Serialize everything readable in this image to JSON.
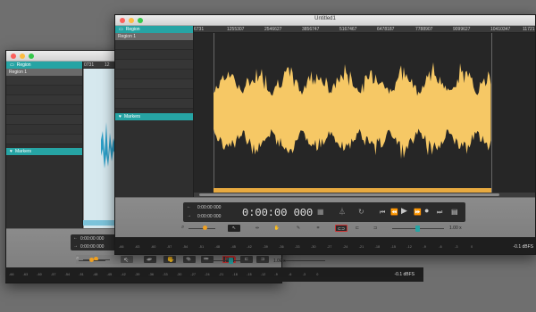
{
  "colors": {
    "accent": "#26a4a4",
    "waveform": "#f6c865",
    "waveform_back": "#2c9ec7",
    "region_bar": "#e8aa40",
    "playhead": "#f0a020"
  },
  "front": {
    "title": "Untitled1",
    "sidebar": {
      "region_header": "Region",
      "region_item": "Region 1",
      "markers_header": "Markers"
    },
    "ruler_ticks": [
      "6731",
      "1255307",
      "2546627",
      "3856747",
      "5167467",
      "6478187",
      "7788907",
      "9099627",
      "10410347",
      "11721"
    ],
    "transport": {
      "start_time": "0:00:00 000",
      "end_time": "0:00:00 000",
      "timecode": "0:00:00 000"
    },
    "zoom": "1.00 x",
    "meter_ticks": [
      "-66",
      "-63",
      "-60",
      "-57",
      "-54",
      "-51",
      "-48",
      "-45",
      "-42",
      "-39",
      "-36",
      "-33",
      "-30",
      "-27",
      "-24",
      "-21",
      "-18",
      "-15",
      "-12",
      "-9",
      "-6",
      "-3",
      "0"
    ],
    "dbfs": "-0.1 dBFS"
  },
  "back": {
    "sidebar": {
      "region_header": "Region",
      "region_item": "Region 1",
      "markers_header": "Markers"
    },
    "ruler_ticks": [
      "0731",
      "12"
    ],
    "transport": {
      "start_time": "0:00:00 000",
      "end_time": "0:00:00 000"
    },
    "zoom": "1.00 x",
    "meter_ticks": [
      "-66",
      "-63",
      "-60",
      "-57",
      "-54",
      "-51",
      "-48",
      "-45",
      "-42",
      "-39",
      "-36",
      "-33",
      "-30",
      "-27",
      "-24",
      "-21",
      "-18",
      "-15",
      "-12",
      "-9",
      "-6",
      "-3",
      "0"
    ],
    "dbfs": "-0.1 dBFS"
  },
  "icons": {
    "rewind": "rewind-icon",
    "back": "back-icon",
    "play": "play-icon",
    "forward": "forward-icon",
    "record": "record-icon",
    "end": "end-icon"
  }
}
